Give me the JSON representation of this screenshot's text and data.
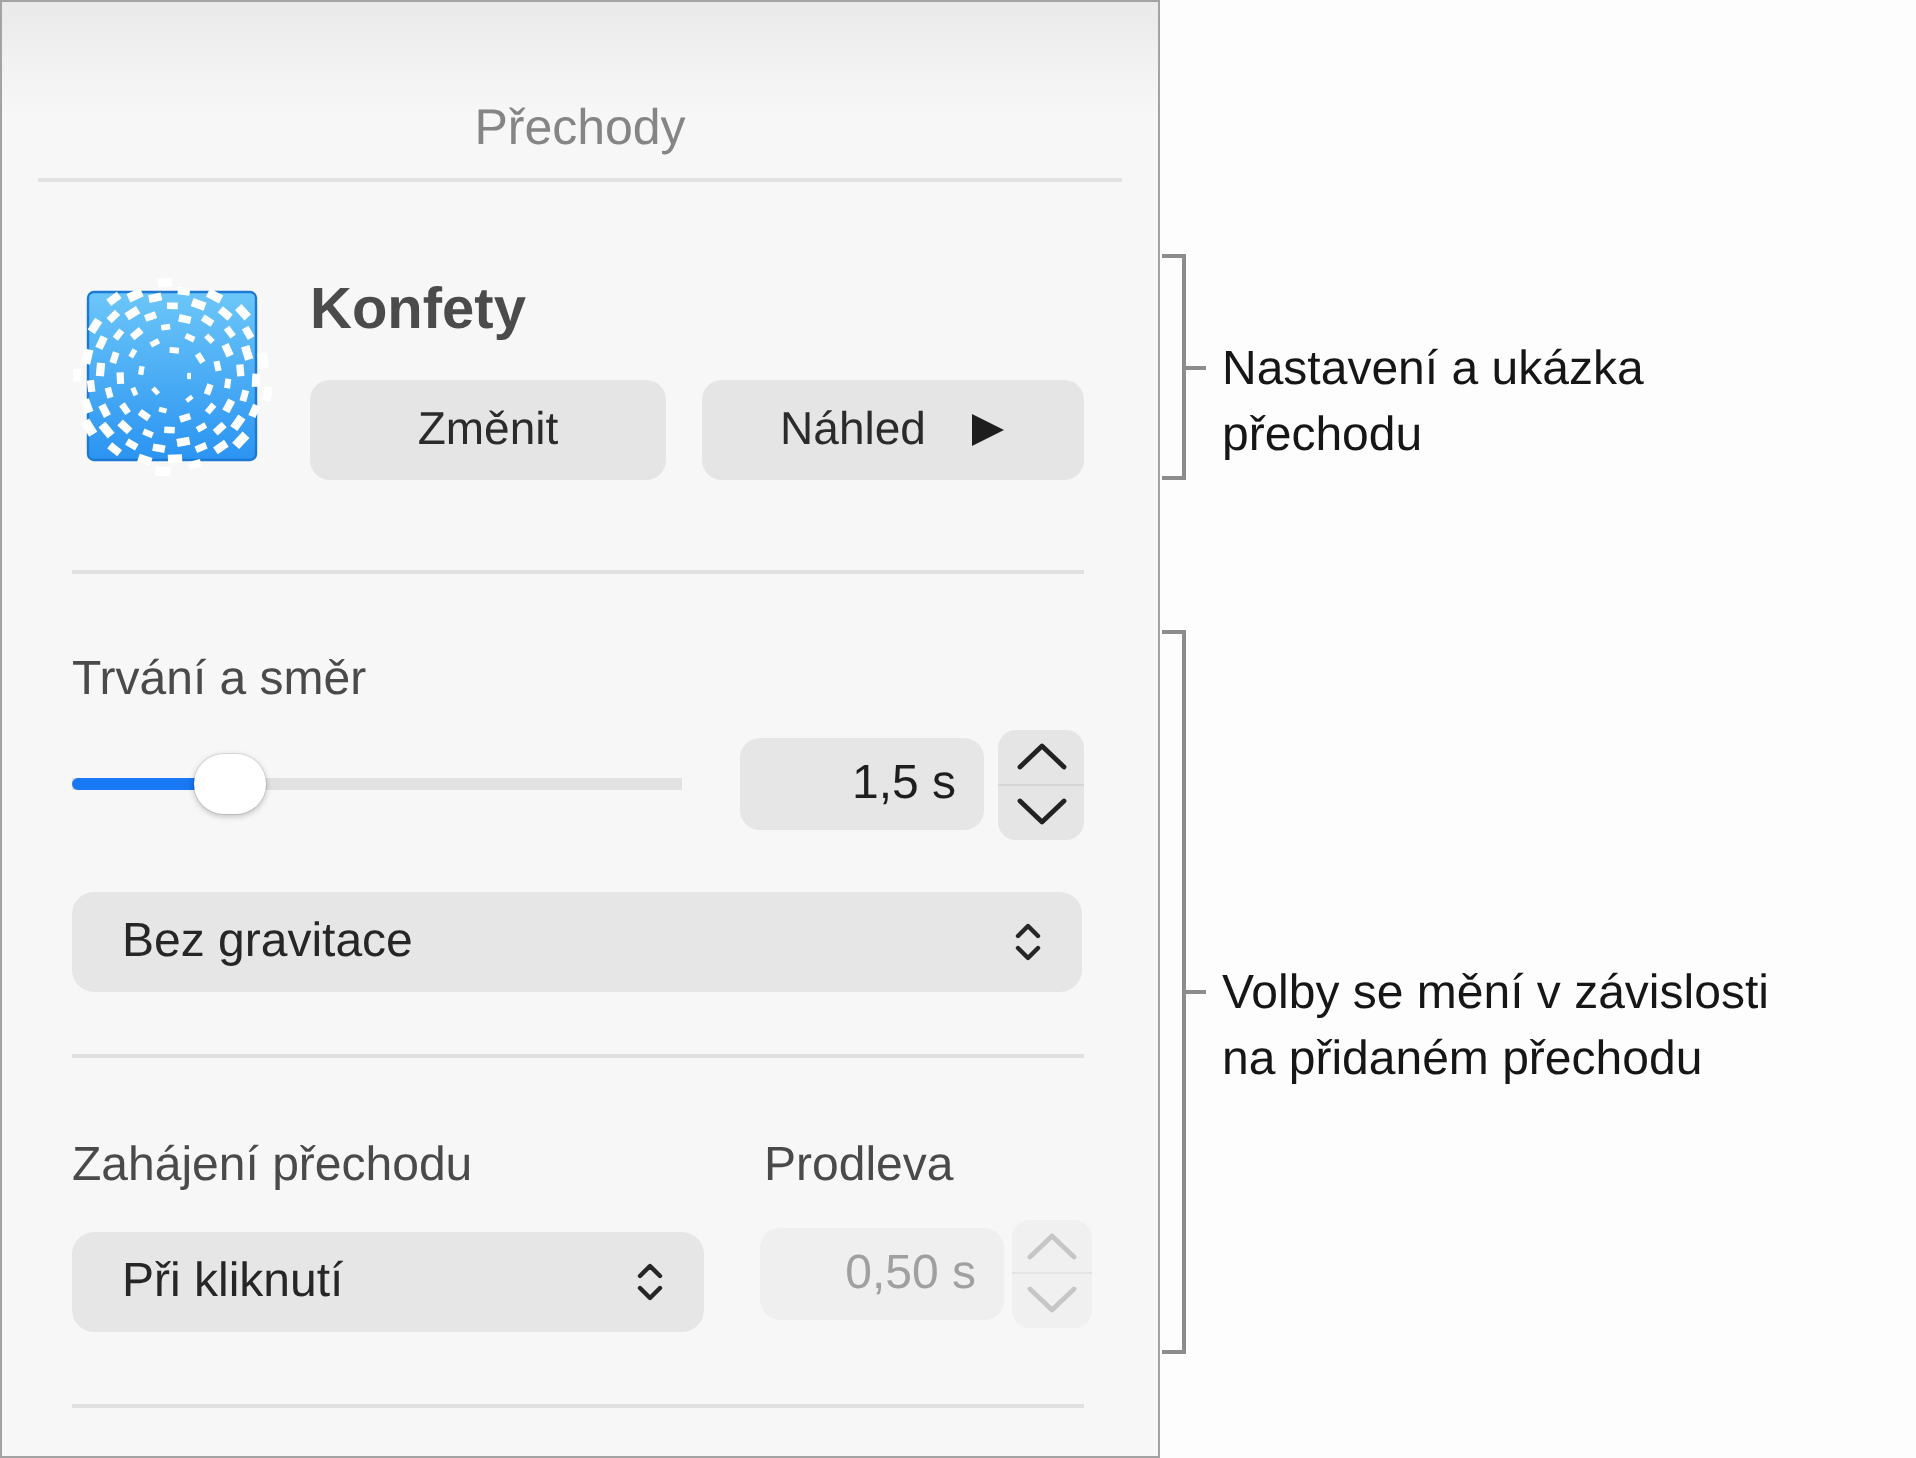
{
  "panel": {
    "title": "Přechody"
  },
  "transition": {
    "name": "Konfety",
    "buttons": [
      {
        "label": "Změnit",
        "kind": "text"
      },
      {
        "label": "Náhled",
        "kind": "play"
      }
    ]
  },
  "duration": {
    "label": "Trvání a směr",
    "level": 0.26,
    "value": "1,5 s",
    "disabled": false
  },
  "gravity": {
    "value": "Bez gravitace"
  },
  "start": {
    "label": "Zahájení přechodu",
    "value": "Při kliknutí"
  },
  "delay": {
    "label": "Prodleva",
    "value": "0,50 s",
    "disabled": true
  },
  "callouts": [
    {
      "text": "Nastavení a ukázka\npřechodu"
    },
    {
      "text": "Volby se mění v závislosti\nna přidaném přechodu"
    }
  ]
}
